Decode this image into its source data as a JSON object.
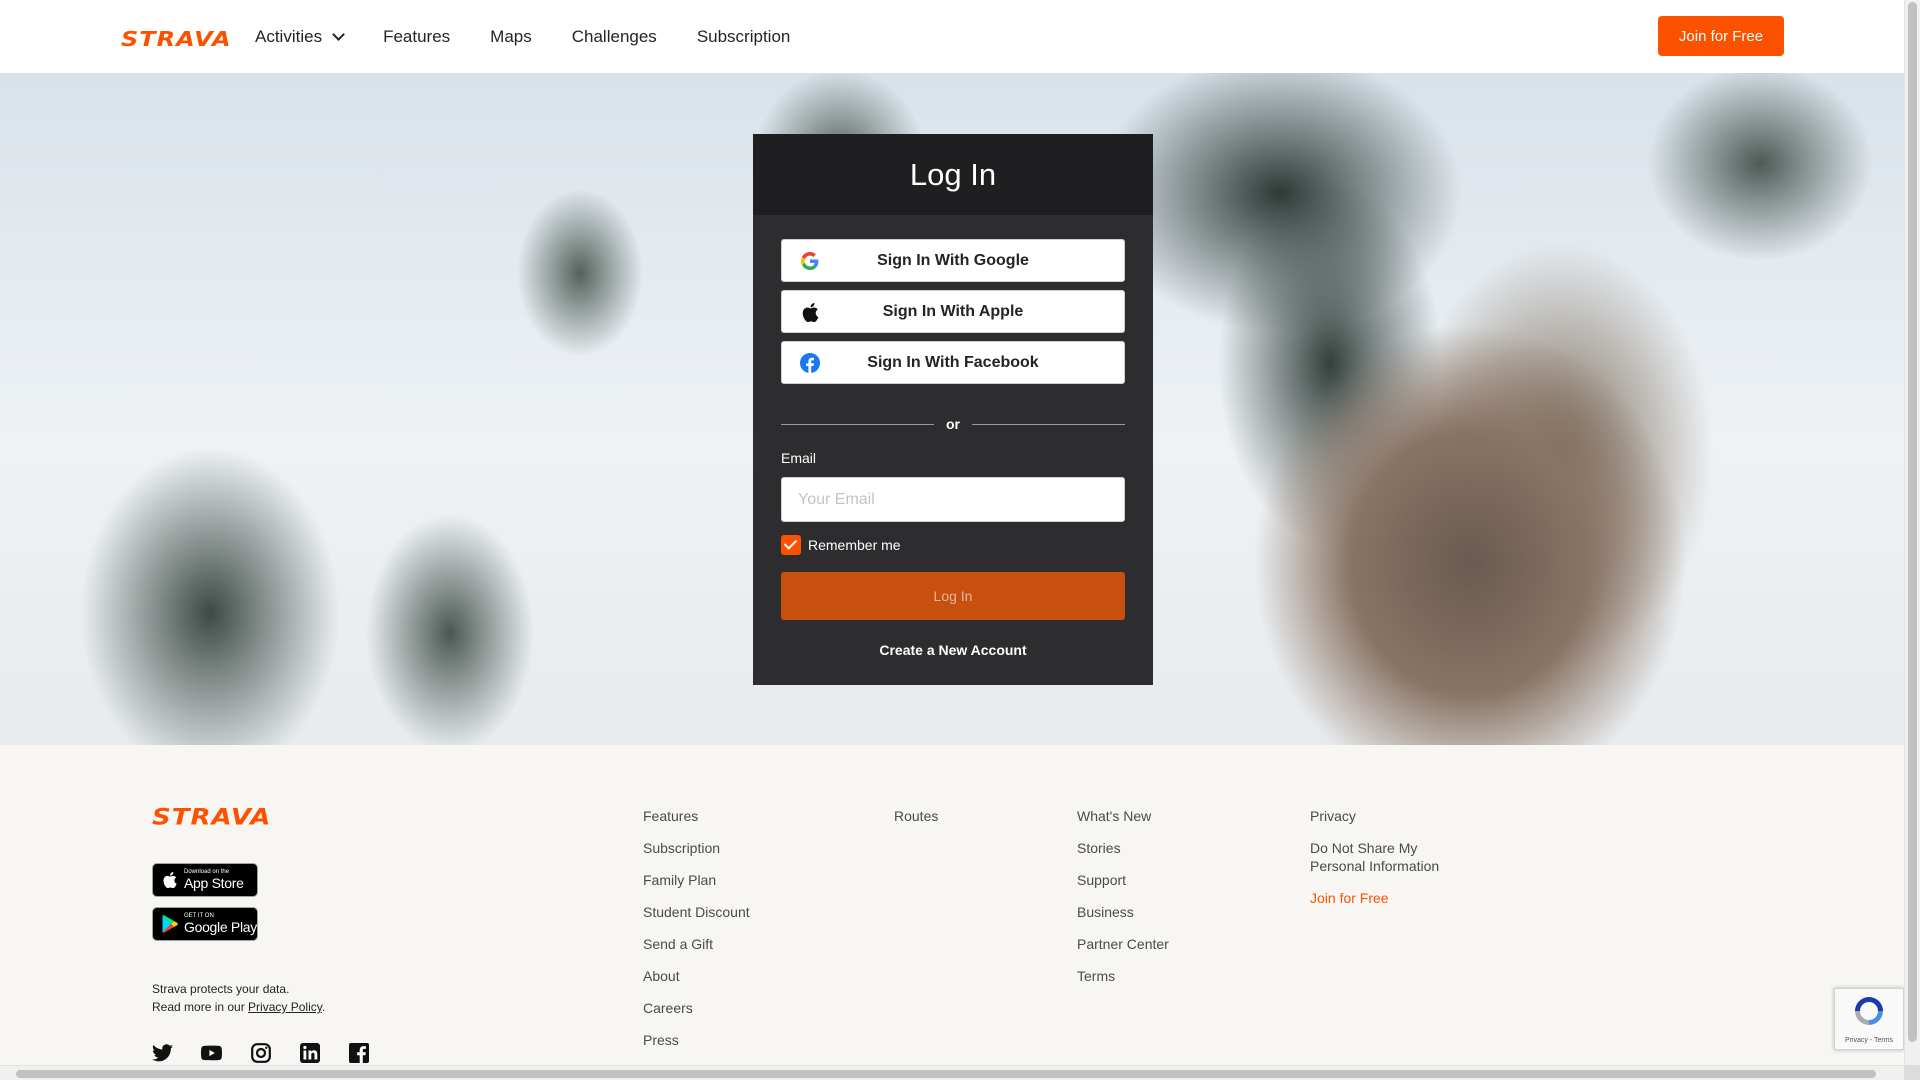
{
  "brand": {
    "name": "STRAVA",
    "color": "#fc5200"
  },
  "nav": {
    "items": [
      {
        "label": "Activities",
        "has_dropdown": true
      },
      {
        "label": "Features"
      },
      {
        "label": "Maps"
      },
      {
        "label": "Challenges"
      },
      {
        "label": "Subscription"
      }
    ],
    "join_label": "Join for Free"
  },
  "login": {
    "title": "Log In",
    "google_label": "Sign In With Google",
    "apple_label": "Sign In With Apple",
    "facebook_label": "Sign In With Facebook",
    "divider_label": "or",
    "email_label": "Email",
    "email_placeholder": "Your Email",
    "email_value": "",
    "remember_label": "Remember me",
    "remember_checked": true,
    "submit_label": "Log In",
    "create_label": "Create a New Account"
  },
  "footer": {
    "logo": "STRAVA",
    "app_store": {
      "small": "Download on the",
      "big": "App Store"
    },
    "google_play": {
      "small": "GET IT ON",
      "big": "Google Play"
    },
    "protect_line1": "Strava protects your data.",
    "protect_line2_prefix": "Read more in our ",
    "privacy_link": "Privacy Policy",
    "protect_line2_suffix": ".",
    "col1": [
      "Features",
      "Subscription",
      "Family Plan",
      "Student Discount",
      "Send a Gift",
      "About",
      "Careers",
      "Press"
    ],
    "col2": [
      "Routes"
    ],
    "col3": [
      "What's New",
      "Stories",
      "Support",
      "Business",
      "Partner Center",
      "Terms"
    ],
    "col4": [
      "Privacy",
      "Do Not Share My Personal Information",
      "Join for Free"
    ],
    "social_icons": [
      "twitter-icon",
      "youtube-icon",
      "instagram-icon",
      "linkedin-icon",
      "facebook-icon"
    ]
  },
  "recaptcha": {
    "text": "Privacy - Terms"
  }
}
